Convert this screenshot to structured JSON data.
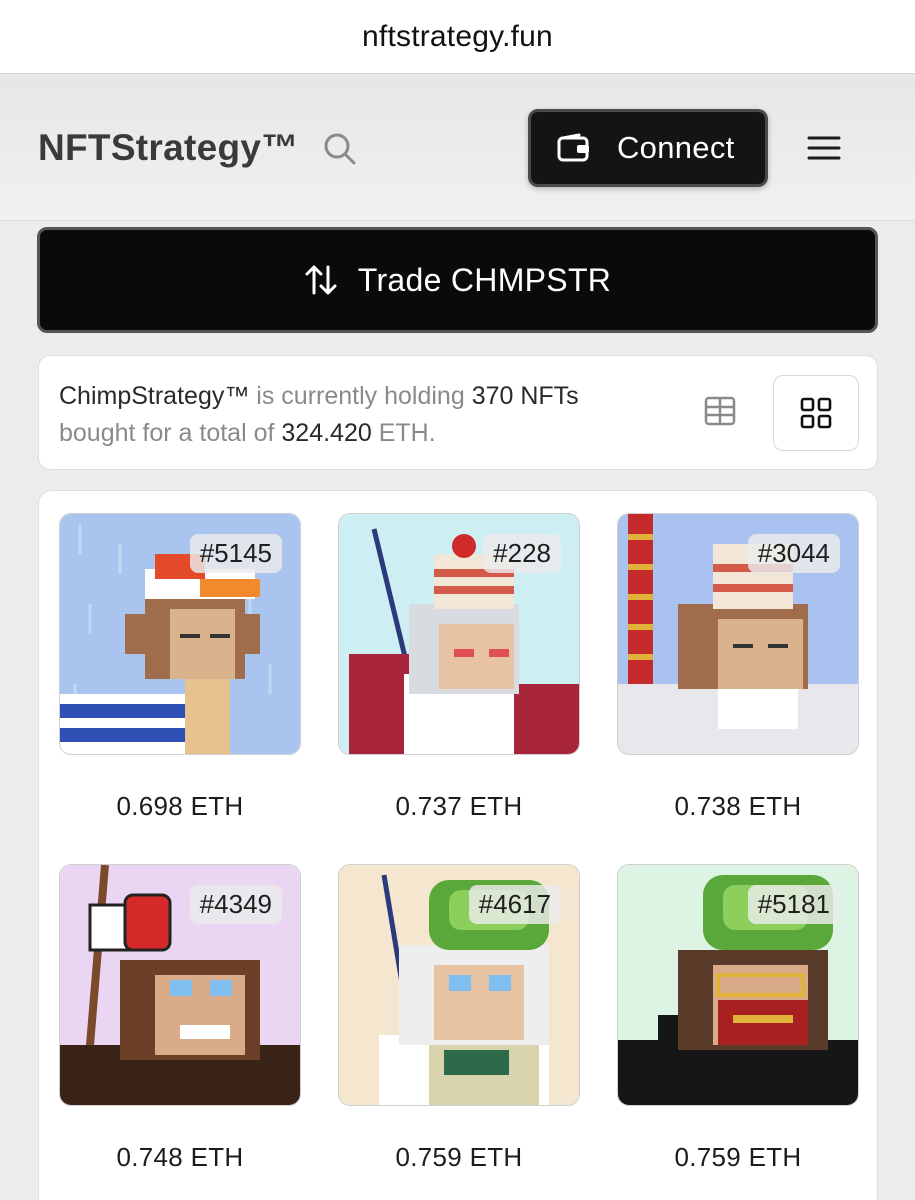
{
  "browser": {
    "url": "nftstrategy.fun"
  },
  "header": {
    "brand": "NFTStrategy™",
    "search_icon": "search-icon",
    "connect_label": "Connect",
    "connect_icon": "wallet-icon",
    "menu_icon": "hamburger-menu-icon"
  },
  "trade": {
    "label": "Trade CHMPSTR",
    "icon": "swap-arrows-icon"
  },
  "info": {
    "name": "ChimpStrategy™",
    "text1": " is currently holding ",
    "count": "370 NFTs",
    "text2": "bought for a total of ",
    "total": "324.420",
    "unit": " ETH."
  },
  "view_toggle": {
    "table_icon": "table-view-icon",
    "grid_icon": "grid-view-icon",
    "selected": "grid"
  },
  "nfts": [
    {
      "id": "#5145",
      "price": "0.698 ETH",
      "bg": "#a9c4ee"
    },
    {
      "id": "#228",
      "price": "0.737 ETH",
      "bg": "#cdeff3"
    },
    {
      "id": "#3044",
      "price": "0.738 ETH",
      "bg": "#a9c2f0"
    },
    {
      "id": "#4349",
      "price": "0.748 ETH",
      "bg": "#ead6f3"
    },
    {
      "id": "#4617",
      "price": "0.759 ETH",
      "bg": "#f5e6cf"
    },
    {
      "id": "#5181",
      "price": "0.759 ETH",
      "bg": "#ddf3e3"
    }
  ]
}
